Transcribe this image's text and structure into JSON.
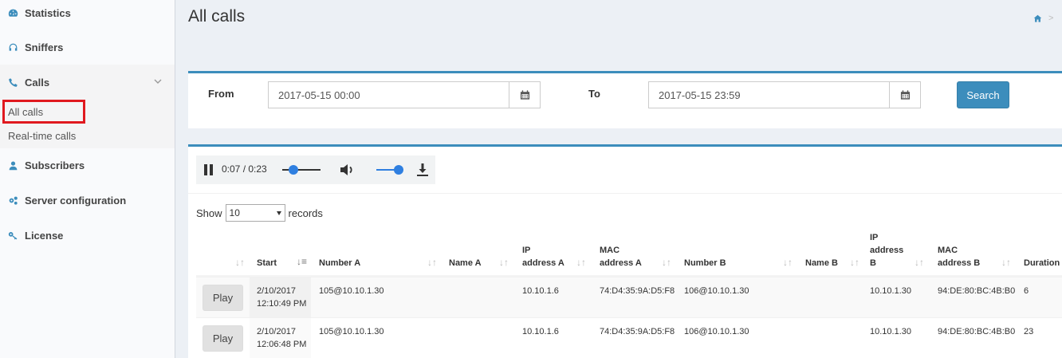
{
  "sidebar": {
    "items": [
      {
        "label": "Statistics",
        "icon": "dashboard-icon"
      },
      {
        "label": "Sniffers",
        "icon": "headphones-icon"
      },
      {
        "label": "Calls",
        "icon": "phone-icon"
      },
      {
        "label": "Subscribers",
        "icon": "user-icon"
      },
      {
        "label": "Server configuration",
        "icon": "gears-icon"
      },
      {
        "label": "License",
        "icon": "key-icon"
      }
    ],
    "submenu": [
      "All calls",
      "Real-time calls"
    ],
    "highlight_color": "#e0191f"
  },
  "page": {
    "title": "All calls",
    "breadcrumb_sep": ">"
  },
  "filter": {
    "from_label": "From",
    "from_value": "2017-05-15 00:00",
    "to_label": "To",
    "to_value": "2017-05-15 23:59",
    "search_label": "Search"
  },
  "player": {
    "time": "0:07 / 0:23",
    "progress": 0.3,
    "volume": 1.0
  },
  "table": {
    "show_label": "Show",
    "page_size": "10",
    "records_label": "records",
    "headers": [
      "",
      "Start",
      "Number A",
      "Name A",
      "IP address A",
      "MAC address A",
      "Number B",
      "Name B",
      "IP address B",
      "MAC address B",
      "Duration"
    ],
    "play_label": "Play",
    "rows": [
      {
        "start_date": "2/10/2017",
        "start_time": "12:10:49 PM",
        "number_a": "105@10.10.1.30",
        "name_a": "",
        "ip_a": "10.10.1.6",
        "mac_a": "74:D4:35:9A:D5:F8",
        "number_b": "106@10.10.1.30",
        "name_b": "",
        "ip_b": "10.10.1.30",
        "mac_b": "94:DE:80:BC:4B:B0",
        "duration": "6"
      },
      {
        "start_date": "2/10/2017",
        "start_time": "12:06:48 PM",
        "number_a": "105@10.10.1.30",
        "name_a": "",
        "ip_a": "10.10.1.6",
        "mac_a": "74:D4:35:9A:D5:F8",
        "number_b": "106@10.10.1.30",
        "name_b": "",
        "ip_b": "10.10.1.30",
        "mac_b": "94:DE:80:BC:4B:B0",
        "duration": "23"
      }
    ]
  },
  "colors": {
    "accent": "#3c8dbc",
    "player_accent": "#2f7fe0"
  }
}
